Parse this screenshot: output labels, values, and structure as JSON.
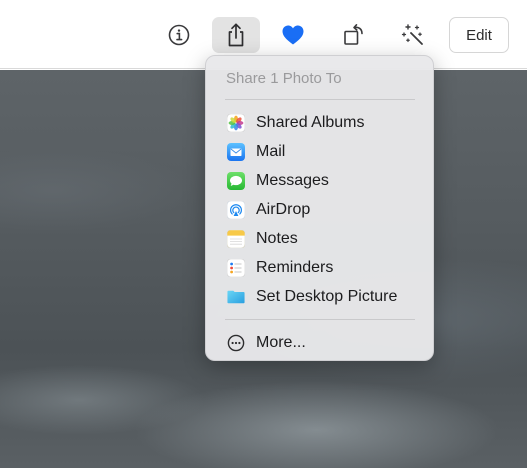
{
  "toolbar": {
    "info_icon": "info-circle-icon",
    "share_icon": "share-icon",
    "favorite_icon": "heart-icon",
    "rotate_icon": "rotate-icon",
    "enhance_icon": "magic-wand-icon",
    "edit_label": "Edit",
    "favorite_color": "#1a6ef5"
  },
  "share_menu": {
    "header": "Share 1 Photo To",
    "items": [
      {
        "label": "Shared Albums",
        "icon": "photos-app-icon"
      },
      {
        "label": "Mail",
        "icon": "mail-app-icon"
      },
      {
        "label": "Messages",
        "icon": "messages-app-icon"
      },
      {
        "label": "AirDrop",
        "icon": "airdrop-icon"
      },
      {
        "label": "Notes",
        "icon": "notes-app-icon"
      },
      {
        "label": "Reminders",
        "icon": "reminders-app-icon"
      },
      {
        "label": "Set Desktop Picture",
        "icon": "desktop-picture-icon"
      }
    ],
    "more_label": "More...",
    "more_icon": "ellipsis-circle-icon"
  }
}
